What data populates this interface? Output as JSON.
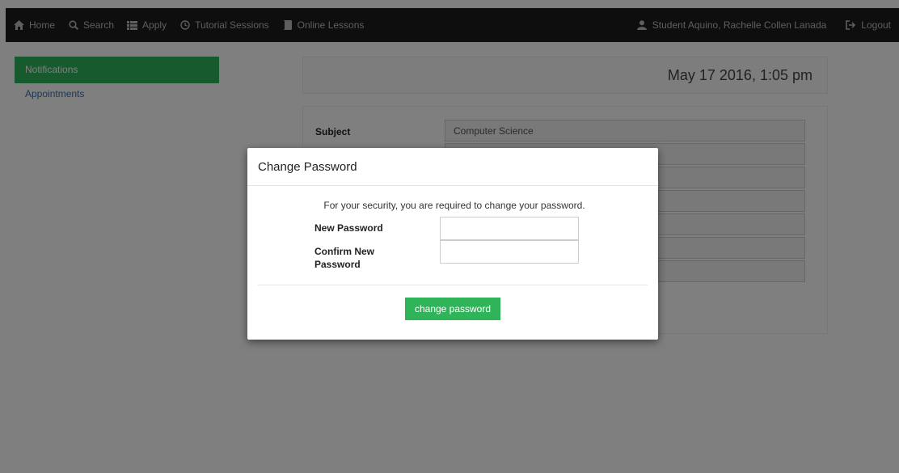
{
  "navbar": {
    "left_items": [
      {
        "label": "Home",
        "icon": "home-icon"
      },
      {
        "label": "Search",
        "icon": "search-icon"
      },
      {
        "label": "Apply",
        "icon": "list-icon"
      },
      {
        "label": "Tutorial Sessions",
        "icon": "clock-icon"
      },
      {
        "label": "Online Lessons",
        "icon": "book-icon"
      }
    ],
    "user_label": "Student Aquino, Rachelle Collen Lanada",
    "logout_label": "Logout"
  },
  "sidebar": {
    "items": [
      {
        "label": "Notifications",
        "active": true
      },
      {
        "label": "Appointments",
        "active": false
      }
    ]
  },
  "main": {
    "datetime": "May 17 2016, 1:05 pm",
    "details": [
      {
        "label": "Subject",
        "value": "Computer Science"
      }
    ]
  },
  "modal": {
    "title": "Change Password",
    "message": "For your security, you are required to change your password.",
    "new_password_label": "New Password",
    "confirm_password_label": "Confirm New Password",
    "new_password_value": "",
    "confirm_password_value": "",
    "submit_label": "change password"
  },
  "colors": {
    "accent_green": "#2fb45a",
    "navbar_bg": "#1c1c1c",
    "link_blue": "#3a6ea5"
  }
}
